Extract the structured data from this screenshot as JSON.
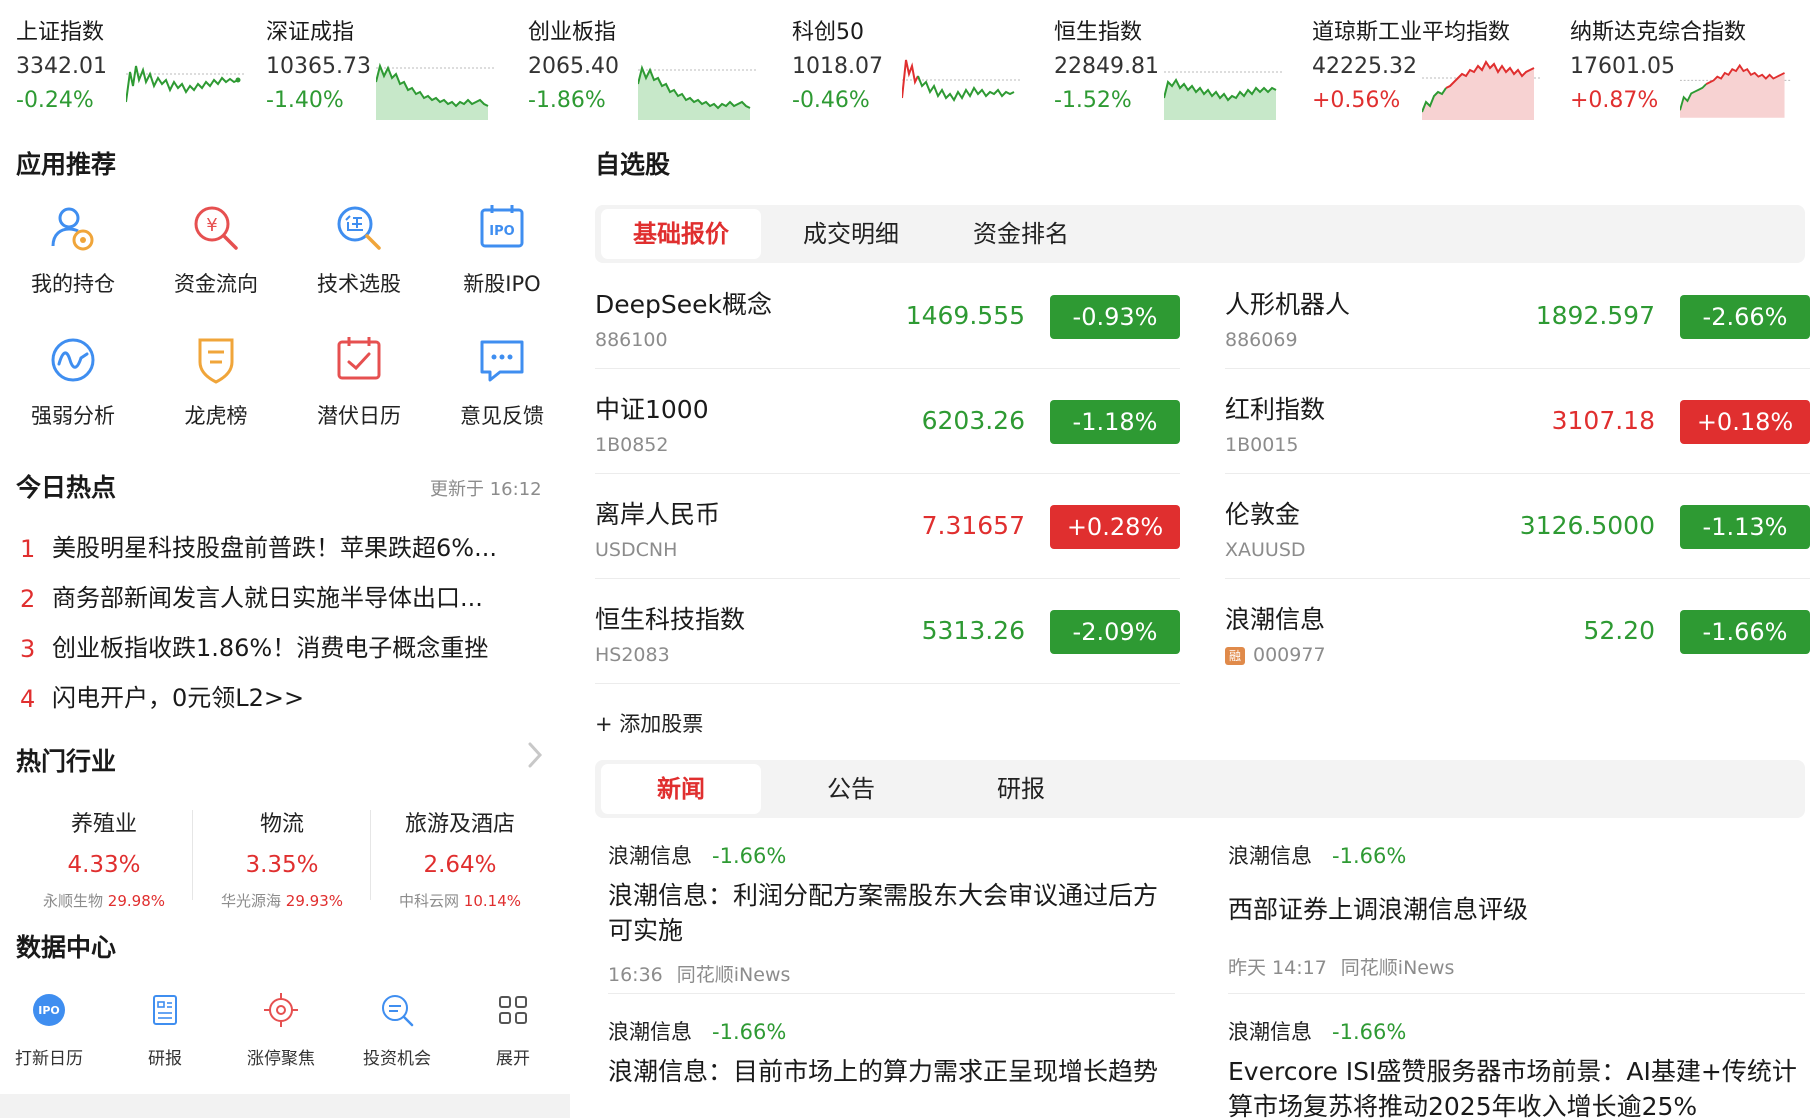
{
  "indices": [
    {
      "name": "上证指数",
      "value": "3342.01",
      "change": "-0.24%",
      "trend": "down"
    },
    {
      "name": "深证成指",
      "value": "10365.73",
      "change": "-1.40%",
      "trend": "down"
    },
    {
      "name": "创业板指",
      "value": "2065.40",
      "change": "-1.86%",
      "trend": "down"
    },
    {
      "name": "科创50",
      "value": "1018.07",
      "change": "-0.46%",
      "trend": "down"
    },
    {
      "name": "恒生指数",
      "value": "22849.81",
      "change": "-1.52%",
      "trend": "down"
    },
    {
      "name": "道琼斯工业平均指数",
      "value": "42225.32",
      "change": "+0.56%",
      "trend": "up"
    },
    {
      "name": "纳斯达克综合指数",
      "value": "17601.05",
      "change": "+0.87%",
      "trend": "up"
    }
  ],
  "apps": {
    "title": "应用推荐",
    "items": [
      {
        "label": "我的持仓",
        "icon": "holdings-icon"
      },
      {
        "label": "资金流向",
        "icon": "fund-flow-icon"
      },
      {
        "label": "技术选股",
        "icon": "stock-picker-icon"
      },
      {
        "label": "新股IPO",
        "icon": "ipo-icon"
      },
      {
        "label": "强弱分析",
        "icon": "strength-analysis-icon"
      },
      {
        "label": "龙虎榜",
        "icon": "dragon-tiger-icon"
      },
      {
        "label": "潜伏日历",
        "icon": "calendar-icon"
      },
      {
        "label": "意见反馈",
        "icon": "feedback-icon"
      }
    ]
  },
  "hot": {
    "title": "今日热点",
    "updated": "更新于 16:12",
    "items": [
      {
        "rank": "1",
        "text": "美股明星科技股盘前普跌！苹果跌超6%..."
      },
      {
        "rank": "2",
        "text": "商务部新闻发言人就日实施半导体出口..."
      },
      {
        "rank": "3",
        "text": "创业板指收跌1.86%！消费电子概念重挫"
      },
      {
        "rank": "4",
        "text": "闪电开户，0元领L2>>"
      }
    ]
  },
  "industries": {
    "title": "热门行业",
    "items": [
      {
        "name": "养殖业",
        "change": "4.33%",
        "leader": "永顺生物",
        "leader_change": "29.98%"
      },
      {
        "name": "物流",
        "change": "3.35%",
        "leader": "华光源海",
        "leader_change": "29.93%"
      },
      {
        "name": "旅游及酒店",
        "change": "2.64%",
        "leader": "中科云网",
        "leader_change": "10.14%"
      }
    ]
  },
  "data_center": {
    "title": "数据中心",
    "items": [
      {
        "label": "打新日历",
        "icon": "ipo-calendar-icon"
      },
      {
        "label": "研报",
        "icon": "research-report-icon"
      },
      {
        "label": "涨停聚焦",
        "icon": "limit-up-focus-icon"
      },
      {
        "label": "投资机会",
        "icon": "opportunity-icon"
      },
      {
        "label": "展开",
        "icon": "expand-grid-icon"
      }
    ]
  },
  "watchlist": {
    "title": "自选股",
    "tabs": [
      "基础报价",
      "成交明细",
      "资金排名"
    ],
    "active_tab": 0,
    "stocks": [
      {
        "name": "DeepSeek概念",
        "code": "886100",
        "price": "1469.555",
        "change": "-0.93%",
        "trend": "down",
        "margin": false
      },
      {
        "name": "人形机器人",
        "code": "886069",
        "price": "1892.597",
        "change": "-2.66%",
        "trend": "down",
        "margin": false
      },
      {
        "name": "中证1000",
        "code": "1B0852",
        "price": "6203.26",
        "change": "-1.18%",
        "trend": "down",
        "margin": false
      },
      {
        "name": "红利指数",
        "code": "1B0015",
        "price": "3107.18",
        "change": "+0.18%",
        "trend": "up",
        "margin": false
      },
      {
        "name": "离岸人民币",
        "code": "USDCNH",
        "price": "7.31657",
        "change": "+0.28%",
        "trend": "up",
        "margin": false
      },
      {
        "name": "伦敦金",
        "code": "XAUUSD",
        "price": "3126.5000",
        "change": "-1.13%",
        "trend": "down",
        "margin": false
      },
      {
        "name": "恒生科技指数",
        "code": "HS2083",
        "price": "5313.26",
        "change": "-2.09%",
        "trend": "down",
        "margin": false
      },
      {
        "name": "浪潮信息",
        "code": "000977",
        "price": "52.20",
        "change": "-1.66%",
        "trend": "down",
        "margin": true
      }
    ],
    "margin_badge": "融",
    "add_label": "+ 添加股票"
  },
  "news": {
    "tabs": [
      "新闻",
      "公告",
      "研报"
    ],
    "active_tab": 0,
    "items": [
      {
        "stock": "浪潮信息",
        "change": "-1.66%",
        "title": "浪潮信息：利润分配方案需股东大会审议通过后方可实施",
        "time": "16:36",
        "source": "同花顺iNews"
      },
      {
        "stock": "浪潮信息",
        "change": "-1.66%",
        "title": "西部证券上调浪潮信息评级",
        "time": "昨天 14:17",
        "source": "同花顺iNews"
      },
      {
        "stock": "浪潮信息",
        "change": "-1.66%",
        "title": "浪潮信息：目前市场上的算力需求正呈现增长趋势",
        "time": "",
        "source": ""
      },
      {
        "stock": "浪潮信息",
        "change": "-1.66%",
        "title": "Evercore ISI盛赞服务器市场前景：AI基建+传统计算市场复苏将推动2025年收入增长逾25%",
        "time": "",
        "source": ""
      }
    ]
  },
  "colors": {
    "up": "#e02f2f",
    "down": "#2e9a33",
    "accent_blue": "#3f8ef0",
    "accent_orange": "#f0a53a"
  }
}
